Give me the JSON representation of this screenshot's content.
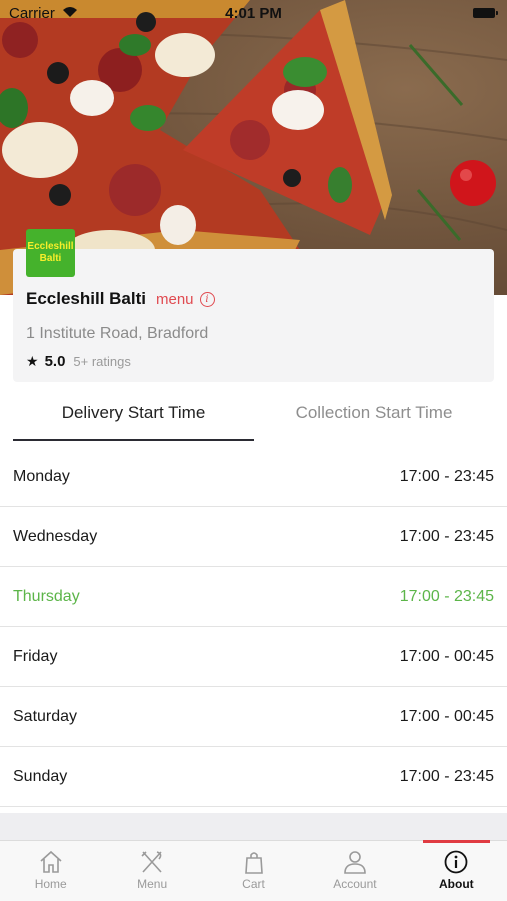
{
  "status_bar": {
    "carrier": "Carrier",
    "time": "4:01 PM"
  },
  "restaurant": {
    "logo_text_line1": "Eccleshill",
    "logo_text_line2": "Balti",
    "name": "Eccleshill Balti",
    "menu_link": "menu",
    "address": "1 Institute Road, Bradford",
    "rating_score": "5.0",
    "rating_count": "5+ ratings"
  },
  "tabs": {
    "delivery": "Delivery Start Time",
    "collection": "Collection Start Time",
    "selected": "delivery"
  },
  "schedule": [
    {
      "day": "Monday",
      "hours": "17:00 - 23:45"
    },
    {
      "day": "Wednesday",
      "hours": "17:00 - 23:45"
    },
    {
      "day": "Thursday",
      "hours": "17:00 - 23:45"
    },
    {
      "day": "Friday",
      "hours": "17:00 - 00:45"
    },
    {
      "day": "Saturday",
      "hours": "17:00 - 00:45"
    },
    {
      "day": "Sunday",
      "hours": "17:00 - 23:45"
    }
  ],
  "highlight_day": "Thursday",
  "tab_bar": [
    {
      "label": "Home",
      "icon": "home-icon"
    },
    {
      "label": "Menu",
      "icon": "cutlery-icon"
    },
    {
      "label": "Cart",
      "icon": "bag-icon"
    },
    {
      "label": "Account",
      "icon": "person-icon"
    },
    {
      "label": "About",
      "icon": "info-icon"
    }
  ],
  "active_tab": "About",
  "colors": {
    "accent_red": "#e04a50",
    "today_green": "#5cb549",
    "logo_green": "#45b22c"
  }
}
